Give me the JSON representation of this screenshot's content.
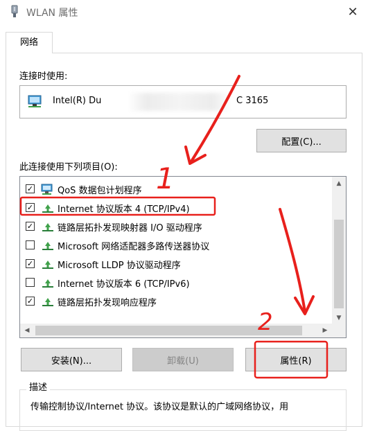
{
  "window": {
    "title": "WLAN 属性",
    "close_glyph": "✕"
  },
  "tabs": [
    {
      "label": "网络",
      "active": true
    }
  ],
  "connect_using": {
    "label": "连接时使用:",
    "adapter_name_start": "Intel(R) Du",
    "adapter_name_end": "C 3165",
    "configure_button": "配置(C)..."
  },
  "components": {
    "label": "此连接使用下列项目(O):",
    "items": [
      {
        "label": "QoS 数据包计划程序",
        "checked": true,
        "icon": "qos-scheduler-icon"
      },
      {
        "label": "Internet 协议版本 4 (TCP/IPv4)",
        "checked": true,
        "icon": "protocol-icon"
      },
      {
        "label": "链路层拓扑发现映射器 I/O 驱动程序",
        "checked": true,
        "icon": "protocol-icon"
      },
      {
        "label": "Microsoft 网络适配器多路传送器协议",
        "checked": false,
        "icon": "protocol-icon"
      },
      {
        "label": "Microsoft LLDP 协议驱动程序",
        "checked": true,
        "icon": "protocol-icon"
      },
      {
        "label": "Internet 协议版本 6 (TCP/IPv6)",
        "checked": false,
        "icon": "protocol-icon"
      },
      {
        "label": "链路层拓扑发现响应程序",
        "checked": true,
        "icon": "protocol-icon"
      }
    ]
  },
  "buttons": {
    "install": "安装(N)...",
    "uninstall": "卸载(U)",
    "properties": "属性(R)"
  },
  "description": {
    "title": "描述",
    "text": "传输控制协议/Internet 协议。该协议是默认的广域网络协议，用"
  },
  "annotations": {
    "marker_1": "1",
    "marker_2": "2",
    "color": "#e8201c"
  }
}
